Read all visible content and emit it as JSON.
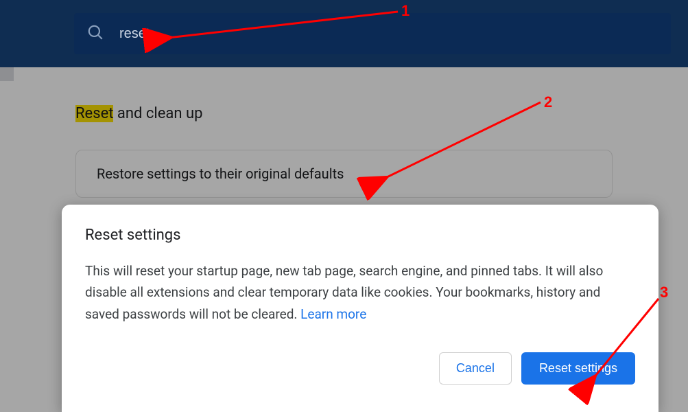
{
  "search": {
    "icon": "search-icon",
    "value": "reset"
  },
  "section": {
    "title_highlight": "Reset",
    "title_rest": " and clean up",
    "card_label": "Restore settings to their original defaults"
  },
  "dialog": {
    "title": "Reset settings",
    "body": "This will reset your startup page, new tab page, search engine, and pinned tabs. It will also disable all extensions and clear temporary data like cookies. Your bookmarks, history and saved passwords will not be cleared. ",
    "learn_more": "Learn more",
    "cancel": "Cancel",
    "confirm": "Reset settings"
  },
  "annotations": {
    "a1": "1",
    "a2": "2",
    "a3": "3"
  },
  "colors": {
    "accent": "#1a73e8",
    "highlight": "#fce205",
    "annotation": "#ff0000"
  }
}
